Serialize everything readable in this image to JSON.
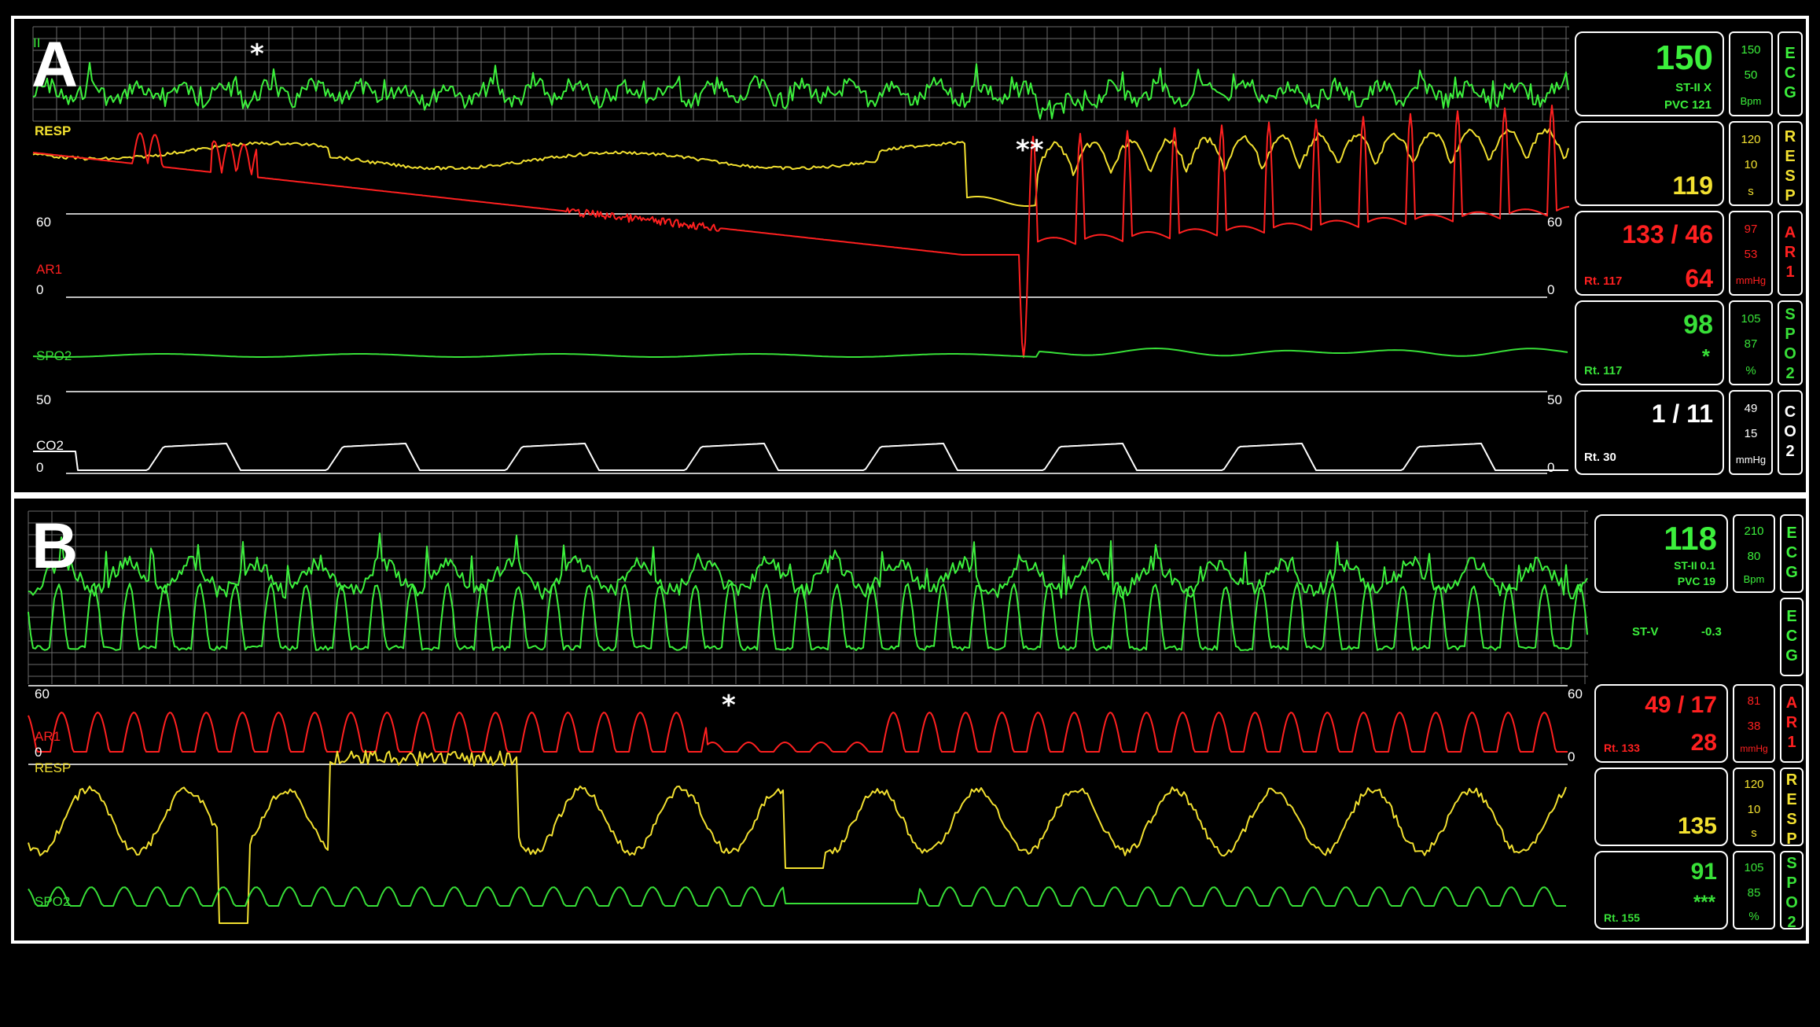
{
  "panelA": {
    "letter": "A",
    "labels": {
      "ecg_lead": "II",
      "resp": "RESP",
      "ar1": "AR1",
      "spo2": "SPO2",
      "co2": "CO2",
      "scale_60": "60",
      "scale_0": "0",
      "scale_50": "50"
    },
    "markers": {
      "single": "*",
      "double": "**"
    },
    "sidebar": {
      "ecg": {
        "value": "150",
        "sub1": "ST-II  X",
        "sub2": "PVC 121",
        "hi": "150",
        "lo": "50",
        "unit": "Bpm",
        "tag": "ECG"
      },
      "resp": {
        "value": "119",
        "hi": "120",
        "lo": "10",
        "unit": "s",
        "tag": "RESP"
      },
      "ar1": {
        "value": "133 / 46",
        "mean": "64",
        "rate": "Rt. 117",
        "hi": "97",
        "lo": "53",
        "unit": "mmHg",
        "tag": "AR1"
      },
      "spo2": {
        "value": "98",
        "quality": "*",
        "rate": "Rt. 117",
        "hi": "105",
        "lo": "87",
        "unit": "%",
        "tag": "SPO2"
      },
      "co2": {
        "value": "1 / 11",
        "rate": "Rt. 30",
        "hi": "49",
        "lo": "15",
        "unit": "mmHg",
        "tag": "CO2"
      }
    }
  },
  "panelB": {
    "letter": "B",
    "labels": {
      "ar1": "AR1",
      "resp": "RESP",
      "spo2": "SPO2",
      "scale_60": "60",
      "scale_0": "0"
    },
    "markers": {
      "single": "*"
    },
    "sidebar": {
      "ecg": {
        "value": "118",
        "sub1": "ST-II  0.1",
        "sub2": "PVC 19",
        "hi": "210",
        "lo": "80",
        "unit": "Bpm",
        "tag": "ECG"
      },
      "ecg2": {
        "label": "ST-V",
        "value": "-0.3",
        "tag": "ECG"
      },
      "ar1": {
        "value": "49 / 17",
        "mean": "28",
        "rate": "Rt. 133",
        "hi": "81",
        "lo": "38",
        "unit": "mmHg",
        "tag": "AR1"
      },
      "resp": {
        "value": "135",
        "hi": "120",
        "lo": "10",
        "unit": "s",
        "tag": "RESP"
      },
      "spo2": {
        "value": "91",
        "quality": "***",
        "rate": "Rt. 155",
        "hi": "105",
        "lo": "85",
        "unit": "%",
        "tag": "SPO2"
      }
    }
  },
  "colors": {
    "ecg": "#3cf03c",
    "resp": "#f2e030",
    "ar1": "#ff2020",
    "spo2": "#38e038",
    "co2": "#ffffff",
    "grid": "#6a6a6a"
  }
}
